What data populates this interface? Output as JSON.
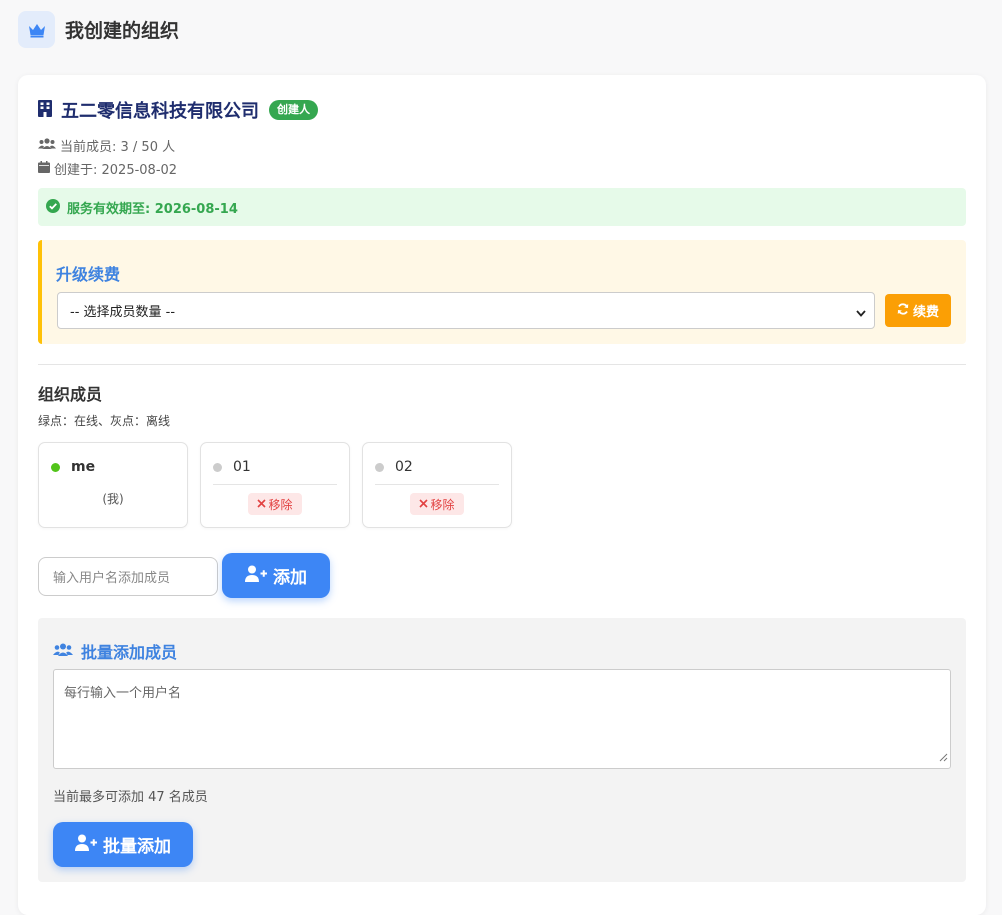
{
  "header": {
    "title": "我创建的组织",
    "icon": "crown-icon",
    "accent": "#3d86f5"
  },
  "org": {
    "name": "五二零信息科技有限公司",
    "badge": "创建人",
    "members_line": "当前成员: 3 / 50 人",
    "created_line": "创建于: 2025-08-02",
    "validity": "服务有效期至: 2026-08-14"
  },
  "upgrade": {
    "title": "升级续费",
    "select_value": "-- 选择成员数量 --",
    "renew_label": "续费"
  },
  "members_section": {
    "title": "组织成员",
    "legend": "绿点：在线、灰点：离线",
    "members": [
      {
        "name": "me",
        "online": true,
        "tag": "(我)"
      },
      {
        "name": "01",
        "online": false,
        "action": "移除"
      },
      {
        "name": "02",
        "online": false,
        "action": "移除"
      }
    ]
  },
  "add_member": {
    "placeholder": "输入用户名添加成员",
    "button_label": "添加"
  },
  "bulk": {
    "title": "批量添加成员",
    "placeholder": "每行输入一个用户名",
    "limit_note": "当前最多可添加 47 名成员",
    "button_label": "批量添加"
  },
  "colors": {
    "online": "#52c41a",
    "offline": "#cccccc",
    "success_bg": "#e6fae9",
    "warning_border": "#ffc107",
    "renew": "#fb9f05",
    "primary": "#3d86f5"
  }
}
